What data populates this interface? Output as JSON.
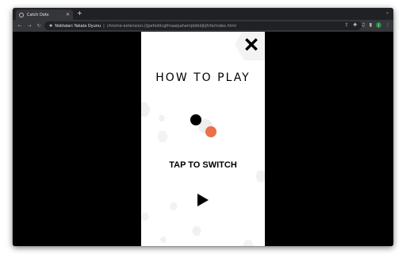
{
  "browser": {
    "tab_title": "Catch Dots",
    "tab_close": "✕",
    "new_tab": "+",
    "tab_search": "⌄",
    "omnibox": {
      "extension_name": "Noktaları Yakala Oyunu",
      "separator": "|",
      "url": "chrome-extension://jpefodiicgfmaaipahemjddkdjkjfcfe/index.html"
    },
    "icons": [
      "back-icon",
      "forward-icon",
      "reload-icon",
      "extension-icon",
      "share-icon",
      "star-icon",
      "puzzle-icon",
      "media-icon",
      "sidebar-icon",
      "profile-icon",
      "menu-icon"
    ],
    "profile_initial": "J"
  },
  "game": {
    "title": "HOW TO PLAY",
    "instruction": "TAP TO SWITCH",
    "colors": {
      "background": "#ffffff",
      "dot_primary": "#000000",
      "dot_secondary": "#e9704a",
      "text": "#000000"
    },
    "icons": {
      "close": "close-icon",
      "play": "play-icon"
    }
  }
}
